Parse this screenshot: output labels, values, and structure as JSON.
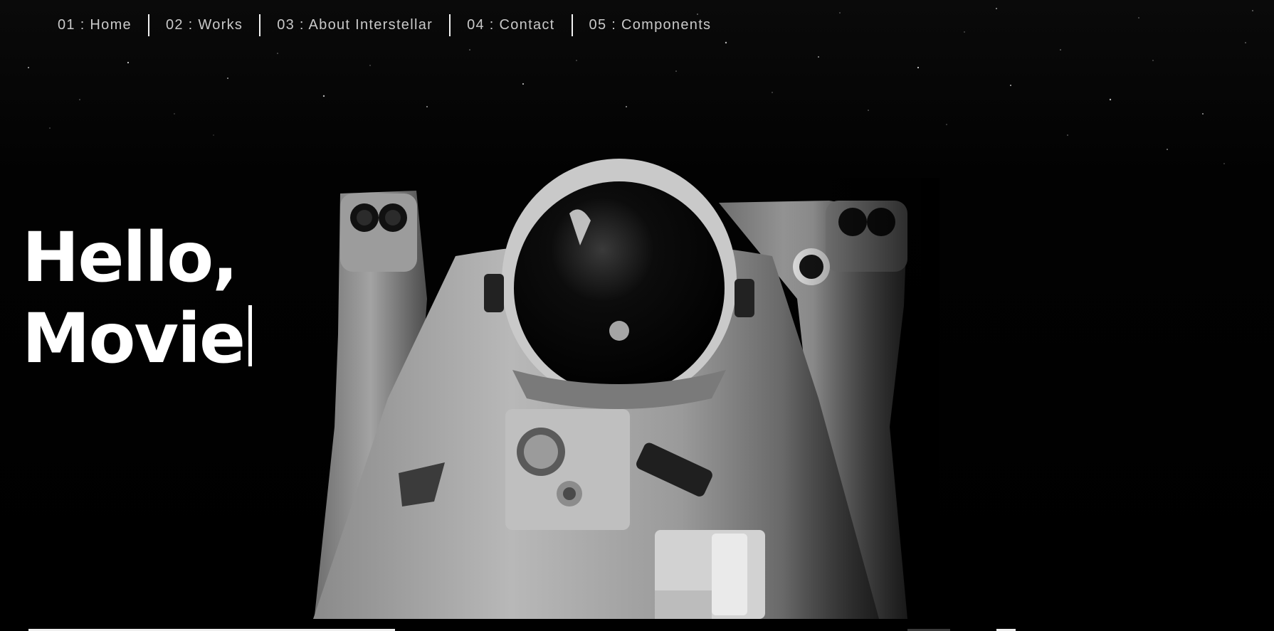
{
  "nav": {
    "items": [
      {
        "label": "01 : Home"
      },
      {
        "label": "02 : Works"
      },
      {
        "label": "03 : About Interstellar"
      },
      {
        "label": "04 : Contact"
      },
      {
        "label": "05 : Components"
      }
    ]
  },
  "hero": {
    "line1": "Hello,",
    "line2": "Movie",
    "image": "astronaut-photo"
  },
  "colors": {
    "background": "#000000",
    "text": "#ffffff",
    "nav_text": "#c9c9c9"
  }
}
